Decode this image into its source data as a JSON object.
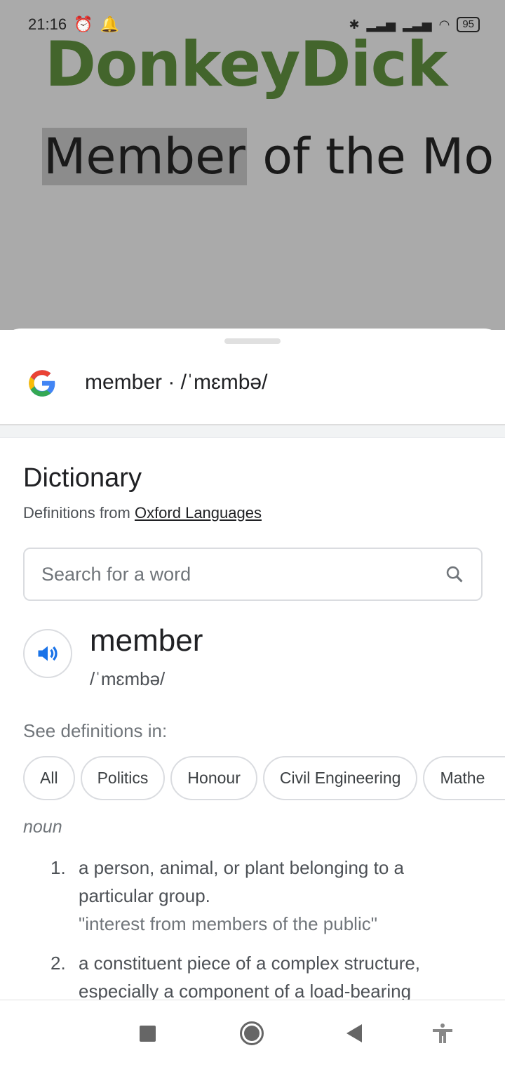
{
  "status_bar": {
    "time": "21:16",
    "battery": "95",
    "colors": {
      "text": "#222222"
    }
  },
  "background_page": {
    "logo_text": "DonkeyDick",
    "headline_selected": "Member",
    "headline_rest": " of the Mo"
  },
  "sheet": {
    "header_title": "member · /ˈmɛmbə/",
    "section_title": "Dictionary",
    "source_prefix": "Definitions from ",
    "source_link": "Oxford Languages",
    "search_placeholder": "Search for a word",
    "word": "member",
    "phonetic": "/ˈmɛmbə/",
    "see_definitions_label": "See definitions in:",
    "chips": [
      "All",
      "Politics",
      "Honour",
      "Civil Engineering",
      "Mathe"
    ],
    "part_of_speech": "noun",
    "definitions": [
      {
        "number": "1.",
        "text": "a person, animal, or plant belonging to a particular group.",
        "example": "\"interest from members of the public\""
      },
      {
        "number": "2.",
        "text": "a constituent piece of a complex structure, especially a component of a load-bearing",
        "example": ""
      }
    ]
  },
  "colors": {
    "logo": "#43652c",
    "accent_blue": "#1a73e8",
    "overlay": "#aaaaaa"
  }
}
